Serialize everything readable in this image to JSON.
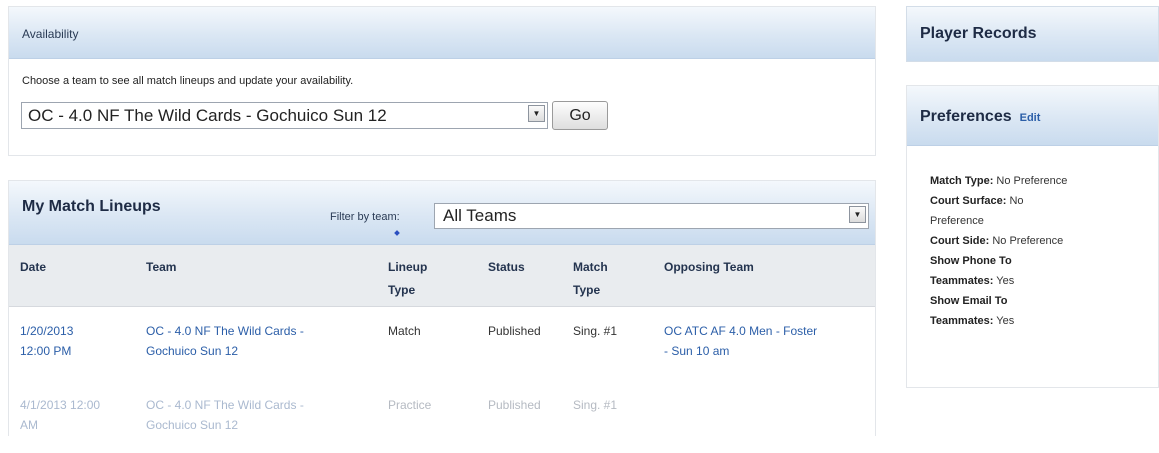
{
  "availability": {
    "title": "Availability",
    "intro": "Choose a team to see all match lineups and update your availability.",
    "team_select_value": "OC - 4.0 NF The Wild Cards - Gochuico Sun 12",
    "go_label": "Go"
  },
  "lineups": {
    "title": "My Match Lineups",
    "filter_label": "Filter by team:",
    "filter_value": "All Teams",
    "columns": {
      "date": "Date",
      "team": "Team",
      "lineup_type_1": "Lineup",
      "lineup_type_2": "Type",
      "status": "Status",
      "match_type_1": "Match",
      "match_type_2": "Type",
      "opposing": "Opposing Team"
    },
    "rows": [
      {
        "date_1": "1/20/2013",
        "date_2": "12:00 PM",
        "team_1": "OC - 4.0 NF The Wild Cards -",
        "team_2": "Gochuico Sun 12",
        "lineup_type": "Match",
        "status": "Published",
        "match_type": "Sing. #1",
        "opposing_1": "OC ATC AF 4.0 Men - Foster",
        "opposing_2": "- Sun 10 am"
      },
      {
        "date_1": "4/1/2013 12:00",
        "date_2": "AM",
        "team_1": "OC - 4.0 NF The Wild Cards -",
        "team_2": "Gochuico Sun 12",
        "lineup_type": "Practice",
        "status": "Published",
        "match_type": "Sing. #1"
      }
    ]
  },
  "player_records": {
    "title": "Player Records"
  },
  "preferences": {
    "title": "Preferences",
    "edit_label": "Edit",
    "match_type_key": "Match Type:",
    "match_type_val": "No Preference",
    "court_surface_key": "Court Surface:",
    "court_surface_val_1": "No",
    "court_surface_val_2": "Preference",
    "court_side_key": "Court Side:",
    "court_side_val": "No Preference",
    "show_phone_key_1": "Show Phone To",
    "show_phone_key_2": "Teammates:",
    "show_phone_val": "Yes",
    "show_email_key_1": "Show Email To",
    "show_email_key_2": "Teammates:",
    "show_email_val": "Yes"
  },
  "icons": {
    "dropdown_arrow": "dropdown-arrow-icon"
  }
}
